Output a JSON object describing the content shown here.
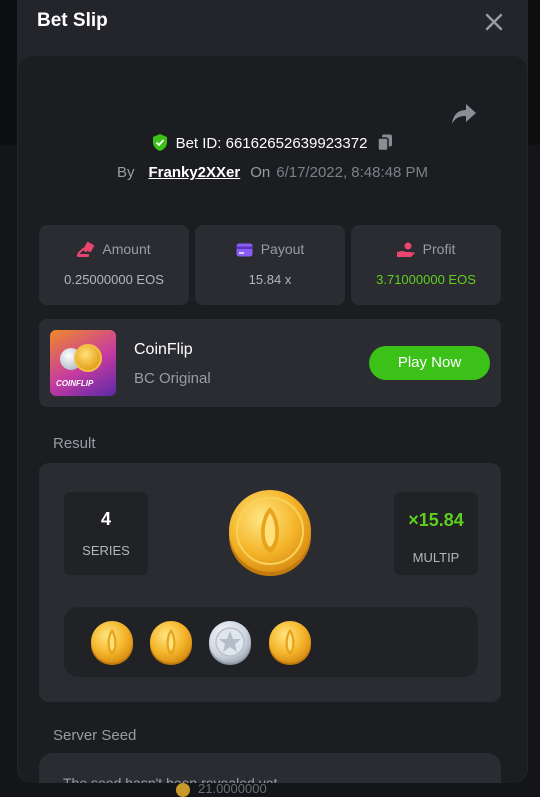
{
  "modal": {
    "title": "Bet Slip",
    "close_icon": "close-icon"
  },
  "bet": {
    "id_label": "Bet ID: 66162652639923372",
    "by_label": "By",
    "user": "Franky2XXer",
    "on_label": "On",
    "date": "6/17/2022, 8:48:48 PM"
  },
  "stats": [
    {
      "name": "amount",
      "label": "Amount",
      "value": "0.25000000 EOS",
      "icon": "amount-icon",
      "color": "#e8456f"
    },
    {
      "name": "payout",
      "label": "Payout",
      "value": "15.84 x",
      "icon": "payout-icon",
      "color": "#8a5cf6"
    },
    {
      "name": "profit",
      "label": "Profit",
      "value": "3.71000000 EOS",
      "icon": "profit-icon",
      "color": "#e8456f"
    }
  ],
  "game": {
    "name": "CoinFlip",
    "subtitle": "BC Original",
    "thumb_label": "COINFLIP",
    "play_label": "Play Now"
  },
  "result": {
    "section_label": "Result",
    "series_value": "4",
    "series_label": "SERIES",
    "multiplier_value": "×15.84",
    "multiplier_label": "MULTIP",
    "coins": [
      "gold",
      "gold",
      "silver",
      "gold"
    ]
  },
  "seed": {
    "section_label": "Server Seed",
    "text": "The seed hasn't been revealed yet"
  },
  "background": {
    "bottom_value": "21.0000000"
  },
  "colors": {
    "accent_green": "#3bc117",
    "profit_green": "#5fcf1d",
    "panel": "#2a2c31",
    "modal": "#23252a"
  }
}
